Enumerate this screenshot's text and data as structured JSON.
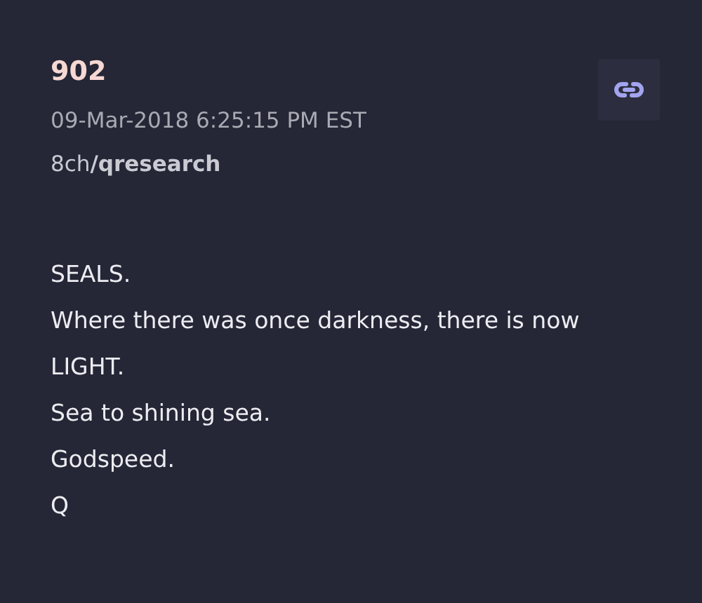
{
  "post": {
    "number": "902",
    "timestamp": "09-Mar-2018 6:25:15 PM EST",
    "source": "8ch**/qresearch**",
    "body_lines": [
      "SEALS.",
      "Where there was once darkness, there is now",
      "LIGHT.",
      "Sea to shining sea.",
      "Godspeed.",
      "Q"
    ]
  }
}
